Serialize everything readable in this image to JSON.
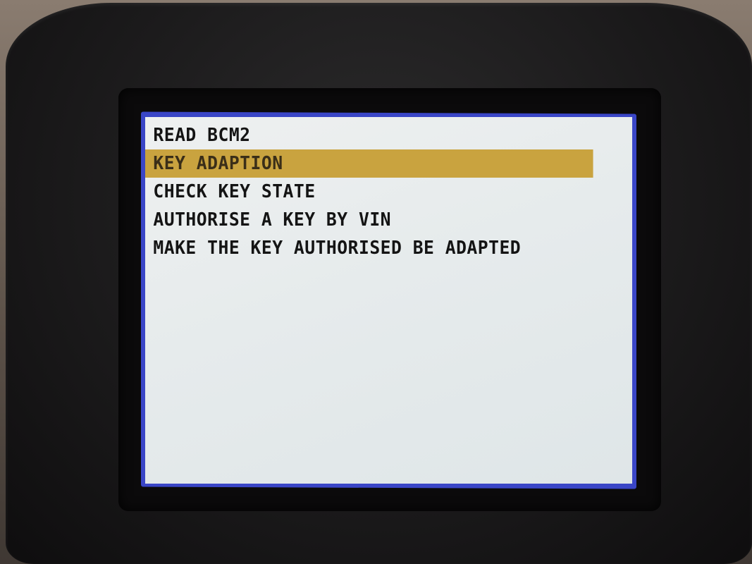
{
  "menu": {
    "items": [
      {
        "label": "READ BCM2",
        "selected": false
      },
      {
        "label": "KEY ADAPTION",
        "selected": true
      },
      {
        "label": "CHECK KEY STATE",
        "selected": false
      },
      {
        "label": "AUTHORISE A KEY BY VIN",
        "selected": false
      },
      {
        "label": "MAKE THE KEY AUTHORISED BE ADAPTED",
        "selected": false
      }
    ]
  },
  "colors": {
    "highlight": "#c9a33f",
    "screen_bg": "#e6ebec",
    "frame": "#3a46c7",
    "text": "#141414"
  }
}
